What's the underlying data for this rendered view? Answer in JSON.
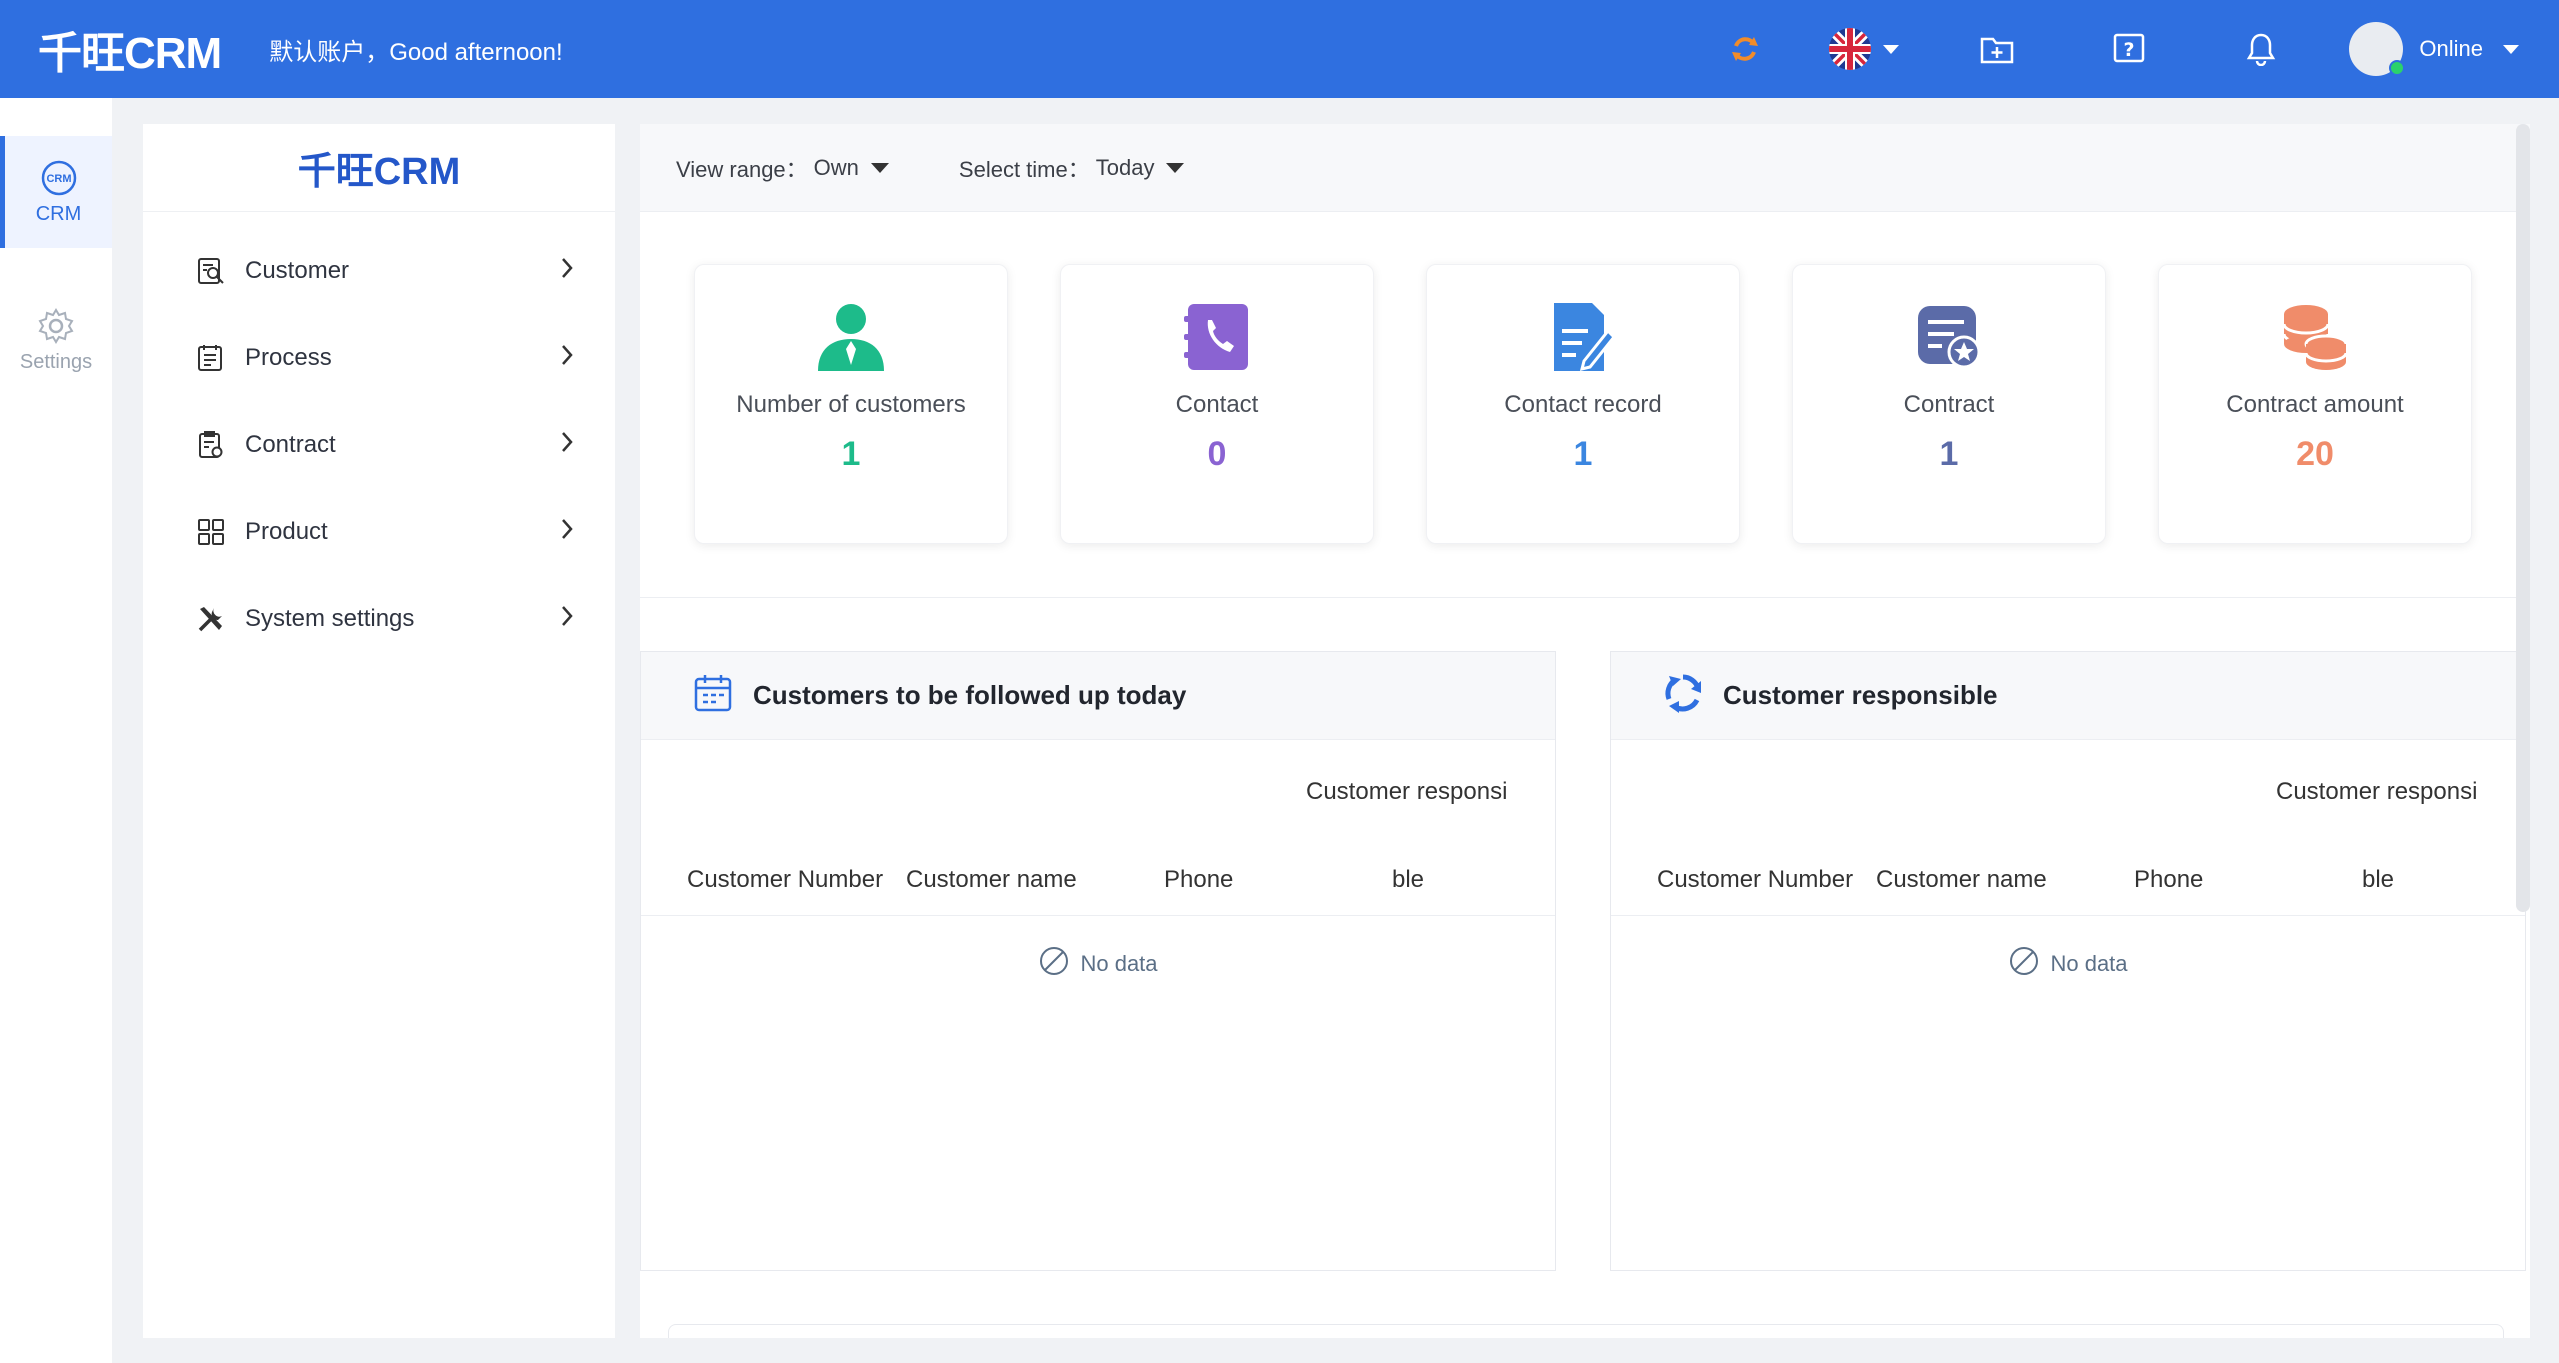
{
  "header": {
    "logo": "千旺CRM",
    "greeting": "默认账户，Good afternoon!",
    "user_status": "Online"
  },
  "rail": {
    "items": [
      {
        "label": "CRM",
        "icon": "crm-icon",
        "active": true
      },
      {
        "label": "Settings",
        "icon": "gear-icon",
        "active": false
      }
    ]
  },
  "menu": {
    "logo": "千旺CRM",
    "items": [
      {
        "label": "Customer",
        "icon": "customer-search-icon"
      },
      {
        "label": "Process",
        "icon": "process-list-icon"
      },
      {
        "label": "Contract",
        "icon": "contract-doc-icon"
      },
      {
        "label": "Product",
        "icon": "product-grid-icon"
      },
      {
        "label": "System settings",
        "icon": "tools-icon"
      }
    ]
  },
  "filters": {
    "view_range_label": "View range：",
    "view_range_value": "Own",
    "select_time_label": "Select time：",
    "select_time_value": "Today"
  },
  "stats": [
    {
      "label": "Number of customers",
      "value": "1",
      "color": "#1dbb8a",
      "icon": "person-icon"
    },
    {
      "label": "Contact",
      "value": "0",
      "color": "#8a63d2",
      "icon": "phone-book-icon"
    },
    {
      "label": "Contact record",
      "value": "1",
      "color": "#3b86e0",
      "icon": "document-edit-icon"
    },
    {
      "label": "Contract",
      "value": "1",
      "color": "#5b6ba8",
      "icon": "contract-badge-icon"
    },
    {
      "label": "Contract amount",
      "value": "20",
      "color": "#f08c6a",
      "icon": "coins-icon"
    }
  ],
  "panels": [
    {
      "title": "Customers to be followed up today",
      "icon": "calendar-icon",
      "columns": [
        "Customer Number",
        "Customer name",
        "Phone",
        "Customer responsi",
        "ble"
      ],
      "empty_text": "No data"
    },
    {
      "title": "Customer responsible",
      "icon": "recycle-icon",
      "columns": [
        "Customer Number",
        "Customer name",
        "Phone",
        "Customer responsi",
        "ble"
      ],
      "empty_text": "No data"
    }
  ]
}
